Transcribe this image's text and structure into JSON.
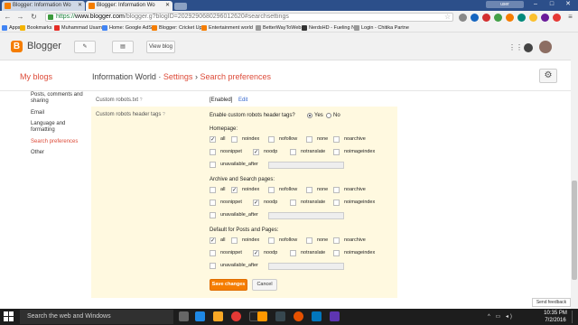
{
  "browser": {
    "tabs": [
      {
        "title": "Blogger: Information Wo"
      },
      {
        "title": "Blogger: Information Wo"
      }
    ],
    "user_chip": "user",
    "url": {
      "scheme": "https://",
      "host": "www.blogger.com",
      "path": "/blogger.g?blogID=2029290680296012620#searchsettings"
    }
  },
  "bookmarks": {
    "items": [
      {
        "label": "Apps",
        "icon": "apps-icon",
        "color": "#4285f4"
      },
      {
        "label": "Bookmarks",
        "icon": "star-icon",
        "color": "#f4b400"
      },
      {
        "label": "Muhammad Usama",
        "icon": "youtube-icon",
        "color": "#e52d27"
      },
      {
        "label": "Home: Google AdSe",
        "icon": "adsense-icon",
        "color": "#4285f4"
      },
      {
        "label": "Blogger: Cricket Upd",
        "icon": "blogger-icon",
        "color": "#f57d00"
      },
      {
        "label": "Entertainment world",
        "icon": "blogger-icon",
        "color": "#f57d00"
      },
      {
        "label": "BetterWayToWeb",
        "icon": "page-icon",
        "color": "#999999"
      },
      {
        "label": "NerdsHD - Fueling N",
        "icon": "nerdshd-icon",
        "color": "#333333"
      },
      {
        "label": "Login - Chitika Partne",
        "icon": "page-icon",
        "color": "#999999"
      }
    ]
  },
  "header": {
    "app_name": "Blogger",
    "view_blog": "View blog",
    "my_blogs": "My blogs",
    "blog_name": "Information World",
    "sep": "·",
    "crumb_settings": "Settings",
    "arrow": "›",
    "crumb_page": "Search preferences"
  },
  "sidebar": {
    "items": [
      {
        "label": "Posts, comments and sharing"
      },
      {
        "label": "Email"
      },
      {
        "label": "Language and formatting"
      },
      {
        "label": "Search preferences"
      },
      {
        "label": "Other"
      }
    ]
  },
  "settings": {
    "custom_robots_txt_label": "Custom robots.txt",
    "custom_robots_txt_value": "[Enabled]",
    "edit_link": "Edit",
    "header_tags_label": "Custom robots header tags",
    "help": "?",
    "enable_question": "Enable custom robots header tags?",
    "yes": "Yes",
    "no": "No",
    "check": "✓",
    "sections": [
      {
        "title": "Homepage:",
        "row1": [
          {
            "label": "all",
            "checked": true
          },
          {
            "label": "noindex",
            "checked": false
          },
          {
            "label": "nofollow",
            "checked": false
          },
          {
            "label": "none",
            "checked": false
          },
          {
            "label": "noarchive",
            "checked": false
          }
        ],
        "row2": [
          {
            "label": "nosnippet",
            "checked": false
          },
          {
            "label": "noodp",
            "checked": true
          },
          {
            "label": "notranslate",
            "checked": false
          },
          {
            "label": "noimageindex",
            "checked": false
          }
        ],
        "row3": {
          "label": "unavailable_after",
          "checked": false,
          "value": ""
        }
      },
      {
        "title": "Archive and Search pages:",
        "row1": [
          {
            "label": "all",
            "checked": false
          },
          {
            "label": "noindex",
            "checked": true
          },
          {
            "label": "nofollow",
            "checked": false
          },
          {
            "label": "none",
            "checked": false
          },
          {
            "label": "noarchive",
            "checked": false
          }
        ],
        "row2": [
          {
            "label": "nosnippet",
            "checked": false
          },
          {
            "label": "noodp",
            "checked": true
          },
          {
            "label": "notranslate",
            "checked": false
          },
          {
            "label": "noimageindex",
            "checked": false
          }
        ],
        "row3": {
          "label": "unavailable_after",
          "checked": false,
          "value": ""
        }
      },
      {
        "title": "Default for Posts and Pages:",
        "row1": [
          {
            "label": "all",
            "checked": true
          },
          {
            "label": "noindex",
            "checked": false
          },
          {
            "label": "nofollow",
            "checked": false
          },
          {
            "label": "none",
            "checked": false
          },
          {
            "label": "noarchive",
            "checked": false
          }
        ],
        "row2": [
          {
            "label": "nosnippet",
            "checked": false
          },
          {
            "label": "noodp",
            "checked": true
          },
          {
            "label": "notranslate",
            "checked": false
          },
          {
            "label": "noimageindex",
            "checked": false
          }
        ],
        "row3": {
          "label": "unavailable_after",
          "checked": false,
          "value": ""
        }
      }
    ],
    "save": "Save changes",
    "cancel": "Cancel"
  },
  "send_feedback": "Send feedback",
  "taskbar": {
    "search_placeholder": "Search the web and Windows",
    "time": "10:35 PM",
    "date": "7/2/2016"
  },
  "colors": {
    "accent": "#f57d00",
    "link_red": "#dd4b39",
    "panel_bg": "#fff9e0"
  }
}
